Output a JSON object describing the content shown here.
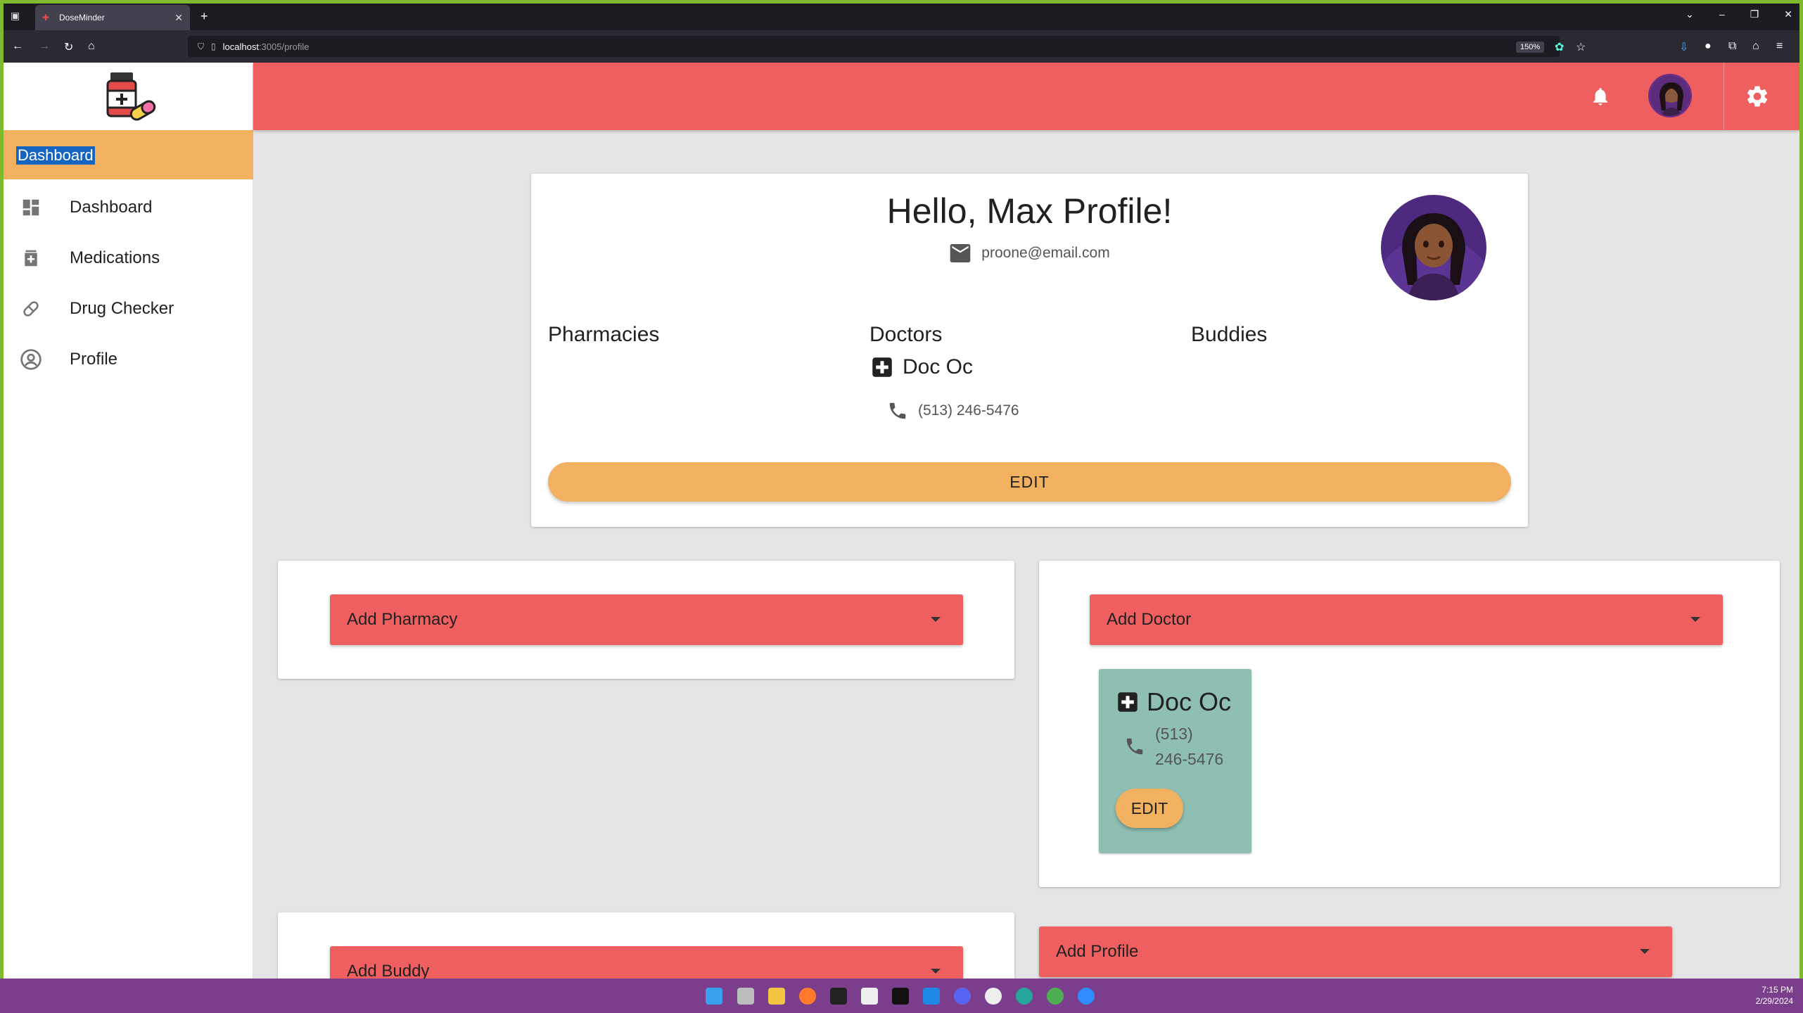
{
  "browser": {
    "tab_title": "DoseMinder",
    "url_host": "localhost",
    "url_path": ":3005/profile",
    "zoom": "150%"
  },
  "sidebar": {
    "active_label": "Dashboard",
    "items": [
      {
        "label": "Dashboard",
        "icon": "dashboard-icon"
      },
      {
        "label": "Medications",
        "icon": "medication-icon"
      },
      {
        "label": "Drug Checker",
        "icon": "pill-icon"
      },
      {
        "label": "Profile",
        "icon": "account-circle-icon"
      }
    ]
  },
  "profile": {
    "greeting": "Hello, Max Profile!",
    "email": "proone@email.com",
    "pharmacies_title": "Pharmacies",
    "doctors_title": "Doctors",
    "buddies_title": "Buddies",
    "doctor_name": "Doc Oc",
    "doctor_phone": "(513) 246-5476",
    "edit_label": "EDIT"
  },
  "add_pharmacy": {
    "label": "Add Pharmacy"
  },
  "add_doctor": {
    "label": "Add Doctor"
  },
  "doctor_card": {
    "name": "Doc Oc",
    "phone_line1": "(513)",
    "phone_line2": "246-5476",
    "edit_label": "EDIT"
  },
  "add_buddy": {
    "label": "Add Buddy"
  },
  "add_profile": {
    "label": "Add Profile"
  },
  "taskbar": {
    "time": "7:15 PM",
    "date": "2/29/2024"
  },
  "colors": {
    "header": "#ef5f5f",
    "accent": "#f2b160",
    "doctor_card": "#8fbfb3"
  }
}
